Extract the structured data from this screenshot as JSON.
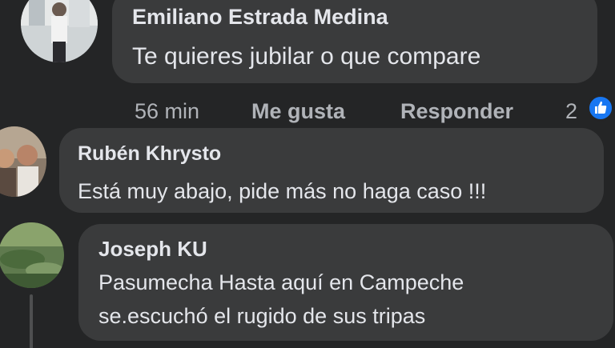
{
  "comments": [
    {
      "author": "Emiliano Estrada Medina",
      "text": "Te quieres jubilar o que compare",
      "actions": {
        "time": "56 min",
        "like": "Me gusta",
        "reply": "Responder"
      },
      "reaction_count": "2"
    },
    {
      "author": "Rubén Khrysto",
      "text": "Está muy abajo, pide más no haga caso !!!"
    },
    {
      "author": "Joseph KU",
      "text_lines": [
        "Pasumecha Hasta aquí en Campeche",
        "se.escuchó el rugido de sus tripas"
      ]
    }
  ],
  "colors": {
    "background": "#242526",
    "bubble": "#3a3b3c",
    "text": "#e4e6eb",
    "secondary": "#b0b3b8",
    "like_blue": "#1877f2"
  },
  "icons": {
    "reaction": "thumbs-up-icon"
  }
}
